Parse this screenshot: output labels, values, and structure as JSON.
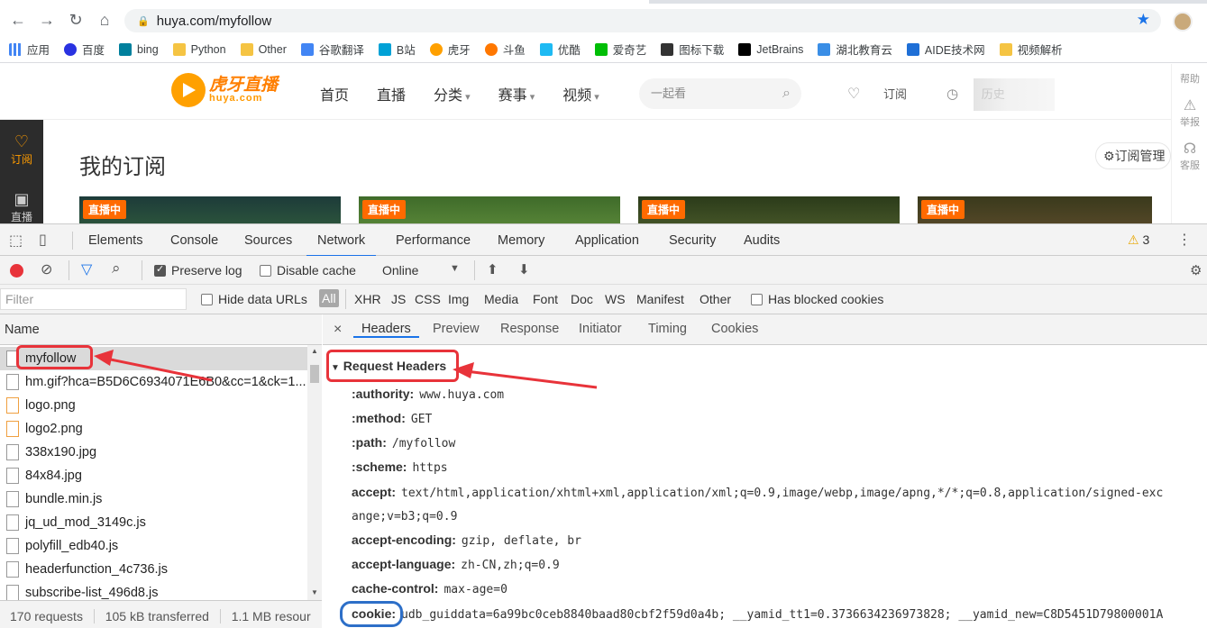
{
  "browser": {
    "url": "huya.com/myfollow",
    "bookmarks": [
      "应用",
      "百度",
      "bing",
      "Python",
      "Other",
      "谷歌翻译",
      "B站",
      "虎牙",
      "斗鱼",
      "优酷",
      "爱奇艺",
      "图标下载",
      "JetBrains",
      "湖北教育云",
      "AIDE技术网",
      "视频解析"
    ]
  },
  "site": {
    "logo_cn": "虎牙直播",
    "logo_en": "huya.com",
    "nav": [
      "首页",
      "直播",
      "分类",
      "赛事",
      "视频"
    ],
    "search_placeholder": "一起看",
    "links": [
      "订阅",
      "历史"
    ],
    "sidebar": [
      "订阅",
      "直播"
    ],
    "rightbar": [
      "帮助",
      "举报",
      "客服"
    ],
    "page_title": "我的订阅",
    "manage_label": "订阅管理",
    "live_badge": "直播中"
  },
  "devtools": {
    "tabs": [
      "Elements",
      "Console",
      "Sources",
      "Network",
      "Performance",
      "Memory",
      "Application",
      "Security",
      "Audits"
    ],
    "active_tab": "Network",
    "warnings": "3",
    "preserve_log": "Preserve log",
    "disable_cache": "Disable cache",
    "throttle": "Online",
    "filter_placeholder": "Filter",
    "hide_data_urls": "Hide data URLs",
    "types": [
      "All",
      "XHR",
      "JS",
      "CSS",
      "Img",
      "Media",
      "Font",
      "Doc",
      "WS",
      "Manifest",
      "Other"
    ],
    "blocked_cookies": "Has blocked cookies",
    "name_header": "Name",
    "requests": [
      "myfollow",
      "hm.gif?hca=B5D6C6934071E6B0&cc=1&ck=1...",
      "logo.png",
      "logo2.png",
      "338x190.jpg",
      "84x84.jpg",
      "bundle.min.js",
      "jq_ud_mod_3149c.js",
      "polyfill_edb40.js",
      "headerfunction_4c736.js",
      "subscribe-list_496d8.js"
    ],
    "status": [
      "170 requests",
      "105 kB transferred",
      "1.1 MB resour"
    ],
    "detail_tabs": [
      "Headers",
      "Preview",
      "Response",
      "Initiator",
      "Timing",
      "Cookies"
    ],
    "section_title": "Request Headers",
    "headers": [
      {
        "k": ":authority:",
        "v": "www.huya.com"
      },
      {
        "k": ":method:",
        "v": "GET"
      },
      {
        "k": ":path:",
        "v": "/myfollow"
      },
      {
        "k": ":scheme:",
        "v": "https"
      },
      {
        "k": "accept:",
        "v": "text/html,application/xhtml+xml,application/xml;q=0.9,image/webp,image/apng,*/*;q=0.8,application/signed-exc"
      },
      {
        "k": "",
        "v": "ange;v=b3;q=0.9"
      },
      {
        "k": "accept-encoding:",
        "v": "gzip, deflate, br"
      },
      {
        "k": "accept-language:",
        "v": "zh-CN,zh;q=0.9"
      },
      {
        "k": "cache-control:",
        "v": "max-age=0"
      },
      {
        "k": "cookie:",
        "v": "udb_guiddata=6a99bc0ceb8840baad80cbf2f59d0a4b; __yamid_tt1=0.3736634236973828; __yamid_new=C8D5451D79800001A"
      }
    ]
  }
}
